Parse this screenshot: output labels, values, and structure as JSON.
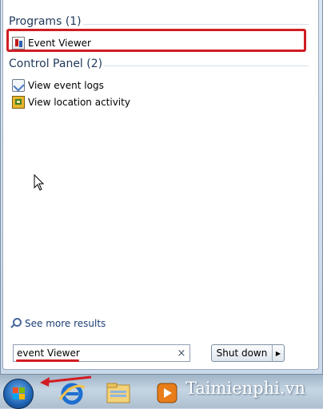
{
  "start_menu": {
    "programs": {
      "heading": "Programs (1)",
      "items": [
        {
          "label": "Event Viewer",
          "icon": "event-viewer-icon"
        }
      ]
    },
    "control_panel": {
      "heading": "Control Panel (2)",
      "items": [
        {
          "label": "View event logs",
          "icon": "event-logs-icon"
        },
        {
          "label": "View location activity",
          "icon": "location-activity-icon"
        }
      ]
    },
    "see_more": "See more results",
    "search": {
      "value": "event Viewer",
      "clear_glyph": "×"
    },
    "shutdown": {
      "label": "Shut down",
      "arrow": "▶"
    }
  },
  "taskbar": {
    "watermark": "Taimienphi.vn"
  },
  "colors": {
    "highlight": "#d01d24",
    "heading": "#1e395b",
    "link": "#1b3f73"
  }
}
